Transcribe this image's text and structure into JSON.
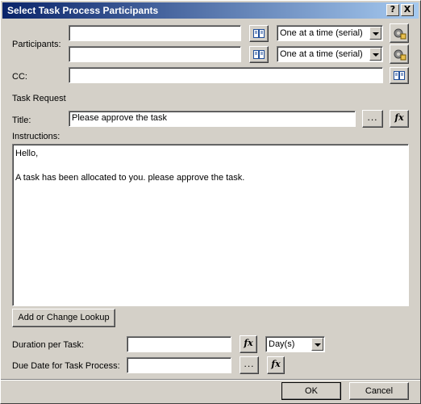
{
  "window": {
    "title": "Select Task Process Participants",
    "help_glyph": "?",
    "close_glyph": "X"
  },
  "participants": {
    "label": "Participants:",
    "rows": [
      {
        "value": "",
        "order": "One at a time (serial)"
      },
      {
        "value": "",
        "order": "One at a time (serial)"
      }
    ]
  },
  "cc": {
    "label": "CC:",
    "value": ""
  },
  "task_request": {
    "section_label": "Task Request",
    "title_label": "Title:",
    "title_value": "Please approve the task",
    "instructions_label": "Instructions:",
    "instructions_value": "Hello,\n\nA task has been allocated to you. please approve the task.",
    "lookup_button": "Add or Change Lookup"
  },
  "duration": {
    "label": "Duration per Task:",
    "value": "",
    "unit": "Day(s)"
  },
  "due_date": {
    "label": "Due Date for Task Process:",
    "value": ""
  },
  "buttons": {
    "ok": "OK",
    "cancel": "Cancel",
    "ellipsis": "...",
    "fx": "fx"
  },
  "icons": {
    "address_book": "address-book-icon",
    "workflow_gear": "gear-icon",
    "function": "function-icon"
  }
}
